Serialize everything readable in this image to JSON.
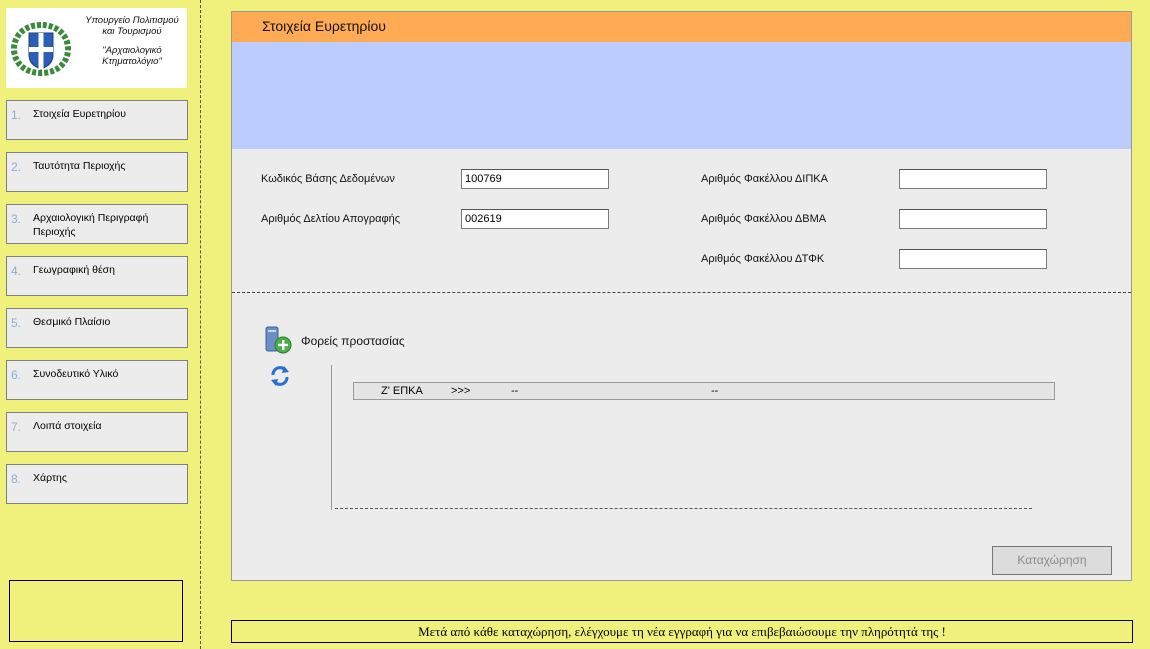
{
  "logo": {
    "line1": "Υπουργείο Πολιτισμού και Τουρισμού",
    "line2": "\"Αρχαιολογικό Κτηματολόγιο\""
  },
  "sidebar": {
    "items": [
      {
        "num": "1.",
        "label": "Στοιχεία Ευρετηρίου"
      },
      {
        "num": "2.",
        "label": "Ταυτότητα Περιοχής"
      },
      {
        "num": "3.",
        "label": "Αρχαιολογική Περιγραφή Περιοχής"
      },
      {
        "num": "4.",
        "label": "Γεωγραφική θέση"
      },
      {
        "num": "5.",
        "label": "Θεσμικό Πλαίσιο"
      },
      {
        "num": "6.",
        "label": "Συνοδευτικό Υλικό"
      },
      {
        "num": "7.",
        "label": "Λοιπά στοιχεία"
      },
      {
        "num": "8.",
        "label": "Χάρτης"
      }
    ]
  },
  "panel": {
    "title": "Στοιχεία Ευρετηρίου",
    "fields": {
      "db_code": {
        "label": "Κωδικός Βάσης Δεδομένων",
        "value": "100769"
      },
      "inventory_no": {
        "label": "Αριθμός Δελτίου Απογραφής",
        "value": "002619"
      },
      "dipka": {
        "label": "Αριθμός Φακέλλου ΔΙΠΚΑ",
        "value": ""
      },
      "dvma": {
        "label": "Αριθμός Φακέλλου ΔΒΜΑ",
        "value": ""
      },
      "dtfk": {
        "label": "Αριθμός Φακέλλου ΔΤΦΚ",
        "value": ""
      }
    },
    "protection": {
      "title": "Φορείς προστασίας",
      "rows": [
        {
          "c1": "Ζ' ΕΠΚΑ",
          "c2": ">>>",
          "c3": "--",
          "c4": "--"
        }
      ]
    },
    "submit_label": "Καταχώρηση"
  },
  "footer": {
    "message": "Μετά από κάθε καταχώρηση, ελέγχουμε τη νέα εγγραφή για να επιβεβαιώσουμε την πληρότητά της !"
  },
  "colors": {
    "background": "#f0f07c",
    "header": "#ffaa55",
    "band": "#bcccff",
    "panel": "#ececec"
  },
  "icons": {
    "logo": "greek-emblem-icon",
    "add": "add-folder-icon",
    "refresh": "refresh-icon"
  }
}
